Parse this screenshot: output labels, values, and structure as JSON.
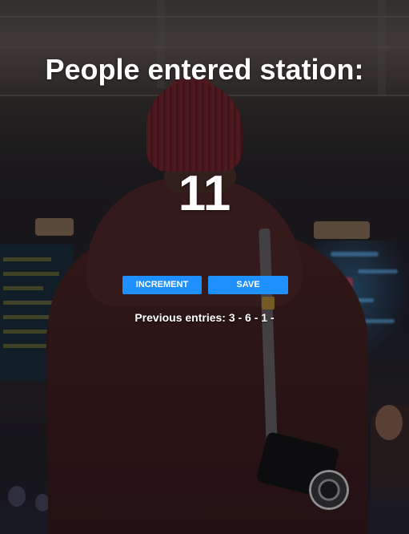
{
  "page": {
    "title": "People entered station:",
    "count": "11"
  },
  "actions": {
    "increment_label": "Increment",
    "save_label": "Save"
  },
  "history": {
    "text": "Previous entries: 3 - 6 - 1 -"
  },
  "colors": {
    "button_bg": "#1e90ff",
    "text": "#ffffff"
  },
  "background": {
    "icon": "train-station-traveler-photo"
  }
}
